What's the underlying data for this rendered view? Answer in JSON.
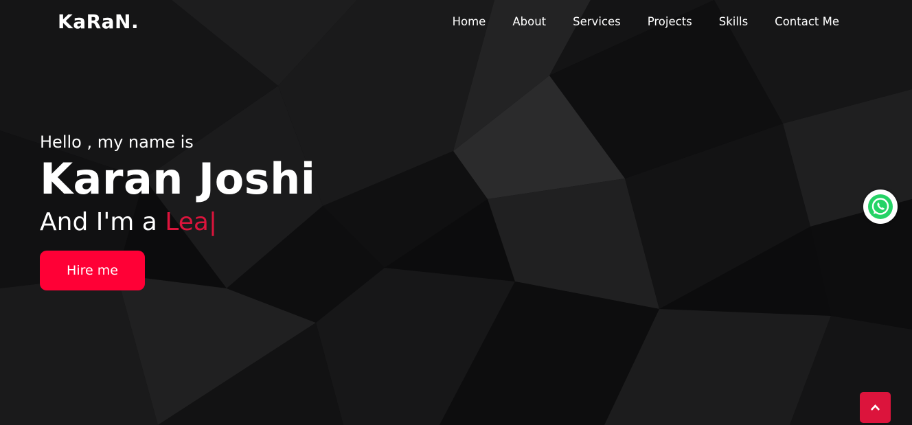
{
  "colors": {
    "accent": "#dc143c",
    "button": "#ff0036",
    "whatsapp_green": "#25d366"
  },
  "navbar": {
    "logo": "KaRaN.",
    "menu": [
      "Home",
      "About",
      "Services",
      "Projects",
      "Skills",
      "Contact Me"
    ]
  },
  "hero": {
    "greeting": "Hello , my name is",
    "name": "Karan Joshi",
    "role_prefix": "And I'm a ",
    "role_typed": "Lea",
    "cursor": "|",
    "hire_button": "Hire me"
  },
  "widgets": {
    "whatsapp_icon": "whatsapp-icon",
    "scroll_top_icon": "chevron-up-icon"
  }
}
